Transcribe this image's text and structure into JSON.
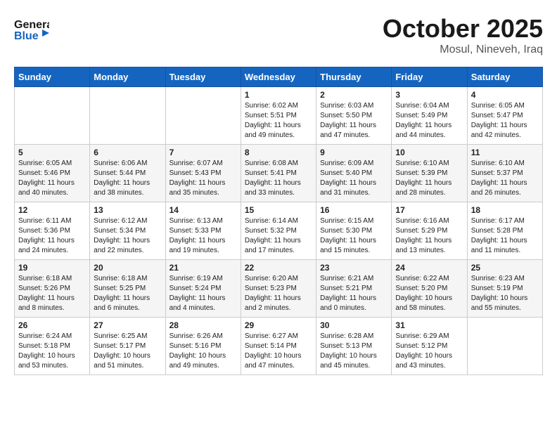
{
  "header": {
    "logo_line1": "General",
    "logo_line2": "Blue",
    "month": "October 2025",
    "location": "Mosul, Nineveh, Iraq"
  },
  "days_of_week": [
    "Sunday",
    "Monday",
    "Tuesday",
    "Wednesday",
    "Thursday",
    "Friday",
    "Saturday"
  ],
  "weeks": [
    [
      {
        "day": "",
        "info": ""
      },
      {
        "day": "",
        "info": ""
      },
      {
        "day": "",
        "info": ""
      },
      {
        "day": "1",
        "info": "Sunrise: 6:02 AM\nSunset: 5:51 PM\nDaylight: 11 hours and 49 minutes."
      },
      {
        "day": "2",
        "info": "Sunrise: 6:03 AM\nSunset: 5:50 PM\nDaylight: 11 hours and 47 minutes."
      },
      {
        "day": "3",
        "info": "Sunrise: 6:04 AM\nSunset: 5:49 PM\nDaylight: 11 hours and 44 minutes."
      },
      {
        "day": "4",
        "info": "Sunrise: 6:05 AM\nSunset: 5:47 PM\nDaylight: 11 hours and 42 minutes."
      }
    ],
    [
      {
        "day": "5",
        "info": "Sunrise: 6:05 AM\nSunset: 5:46 PM\nDaylight: 11 hours and 40 minutes."
      },
      {
        "day": "6",
        "info": "Sunrise: 6:06 AM\nSunset: 5:44 PM\nDaylight: 11 hours and 38 minutes."
      },
      {
        "day": "7",
        "info": "Sunrise: 6:07 AM\nSunset: 5:43 PM\nDaylight: 11 hours and 35 minutes."
      },
      {
        "day": "8",
        "info": "Sunrise: 6:08 AM\nSunset: 5:41 PM\nDaylight: 11 hours and 33 minutes."
      },
      {
        "day": "9",
        "info": "Sunrise: 6:09 AM\nSunset: 5:40 PM\nDaylight: 11 hours and 31 minutes."
      },
      {
        "day": "10",
        "info": "Sunrise: 6:10 AM\nSunset: 5:39 PM\nDaylight: 11 hours and 28 minutes."
      },
      {
        "day": "11",
        "info": "Sunrise: 6:10 AM\nSunset: 5:37 PM\nDaylight: 11 hours and 26 minutes."
      }
    ],
    [
      {
        "day": "12",
        "info": "Sunrise: 6:11 AM\nSunset: 5:36 PM\nDaylight: 11 hours and 24 minutes."
      },
      {
        "day": "13",
        "info": "Sunrise: 6:12 AM\nSunset: 5:34 PM\nDaylight: 11 hours and 22 minutes."
      },
      {
        "day": "14",
        "info": "Sunrise: 6:13 AM\nSunset: 5:33 PM\nDaylight: 11 hours and 19 minutes."
      },
      {
        "day": "15",
        "info": "Sunrise: 6:14 AM\nSunset: 5:32 PM\nDaylight: 11 hours and 17 minutes."
      },
      {
        "day": "16",
        "info": "Sunrise: 6:15 AM\nSunset: 5:30 PM\nDaylight: 11 hours and 15 minutes."
      },
      {
        "day": "17",
        "info": "Sunrise: 6:16 AM\nSunset: 5:29 PM\nDaylight: 11 hours and 13 minutes."
      },
      {
        "day": "18",
        "info": "Sunrise: 6:17 AM\nSunset: 5:28 PM\nDaylight: 11 hours and 11 minutes."
      }
    ],
    [
      {
        "day": "19",
        "info": "Sunrise: 6:18 AM\nSunset: 5:26 PM\nDaylight: 11 hours and 8 minutes."
      },
      {
        "day": "20",
        "info": "Sunrise: 6:18 AM\nSunset: 5:25 PM\nDaylight: 11 hours and 6 minutes."
      },
      {
        "day": "21",
        "info": "Sunrise: 6:19 AM\nSunset: 5:24 PM\nDaylight: 11 hours and 4 minutes."
      },
      {
        "day": "22",
        "info": "Sunrise: 6:20 AM\nSunset: 5:23 PM\nDaylight: 11 hours and 2 minutes."
      },
      {
        "day": "23",
        "info": "Sunrise: 6:21 AM\nSunset: 5:21 PM\nDaylight: 11 hours and 0 minutes."
      },
      {
        "day": "24",
        "info": "Sunrise: 6:22 AM\nSunset: 5:20 PM\nDaylight: 10 hours and 58 minutes."
      },
      {
        "day": "25",
        "info": "Sunrise: 6:23 AM\nSunset: 5:19 PM\nDaylight: 10 hours and 55 minutes."
      }
    ],
    [
      {
        "day": "26",
        "info": "Sunrise: 6:24 AM\nSunset: 5:18 PM\nDaylight: 10 hours and 53 minutes."
      },
      {
        "day": "27",
        "info": "Sunrise: 6:25 AM\nSunset: 5:17 PM\nDaylight: 10 hours and 51 minutes."
      },
      {
        "day": "28",
        "info": "Sunrise: 6:26 AM\nSunset: 5:16 PM\nDaylight: 10 hours and 49 minutes."
      },
      {
        "day": "29",
        "info": "Sunrise: 6:27 AM\nSunset: 5:14 PM\nDaylight: 10 hours and 47 minutes."
      },
      {
        "day": "30",
        "info": "Sunrise: 6:28 AM\nSunset: 5:13 PM\nDaylight: 10 hours and 45 minutes."
      },
      {
        "day": "31",
        "info": "Sunrise: 6:29 AM\nSunset: 5:12 PM\nDaylight: 10 hours and 43 minutes."
      },
      {
        "day": "",
        "info": ""
      }
    ]
  ]
}
